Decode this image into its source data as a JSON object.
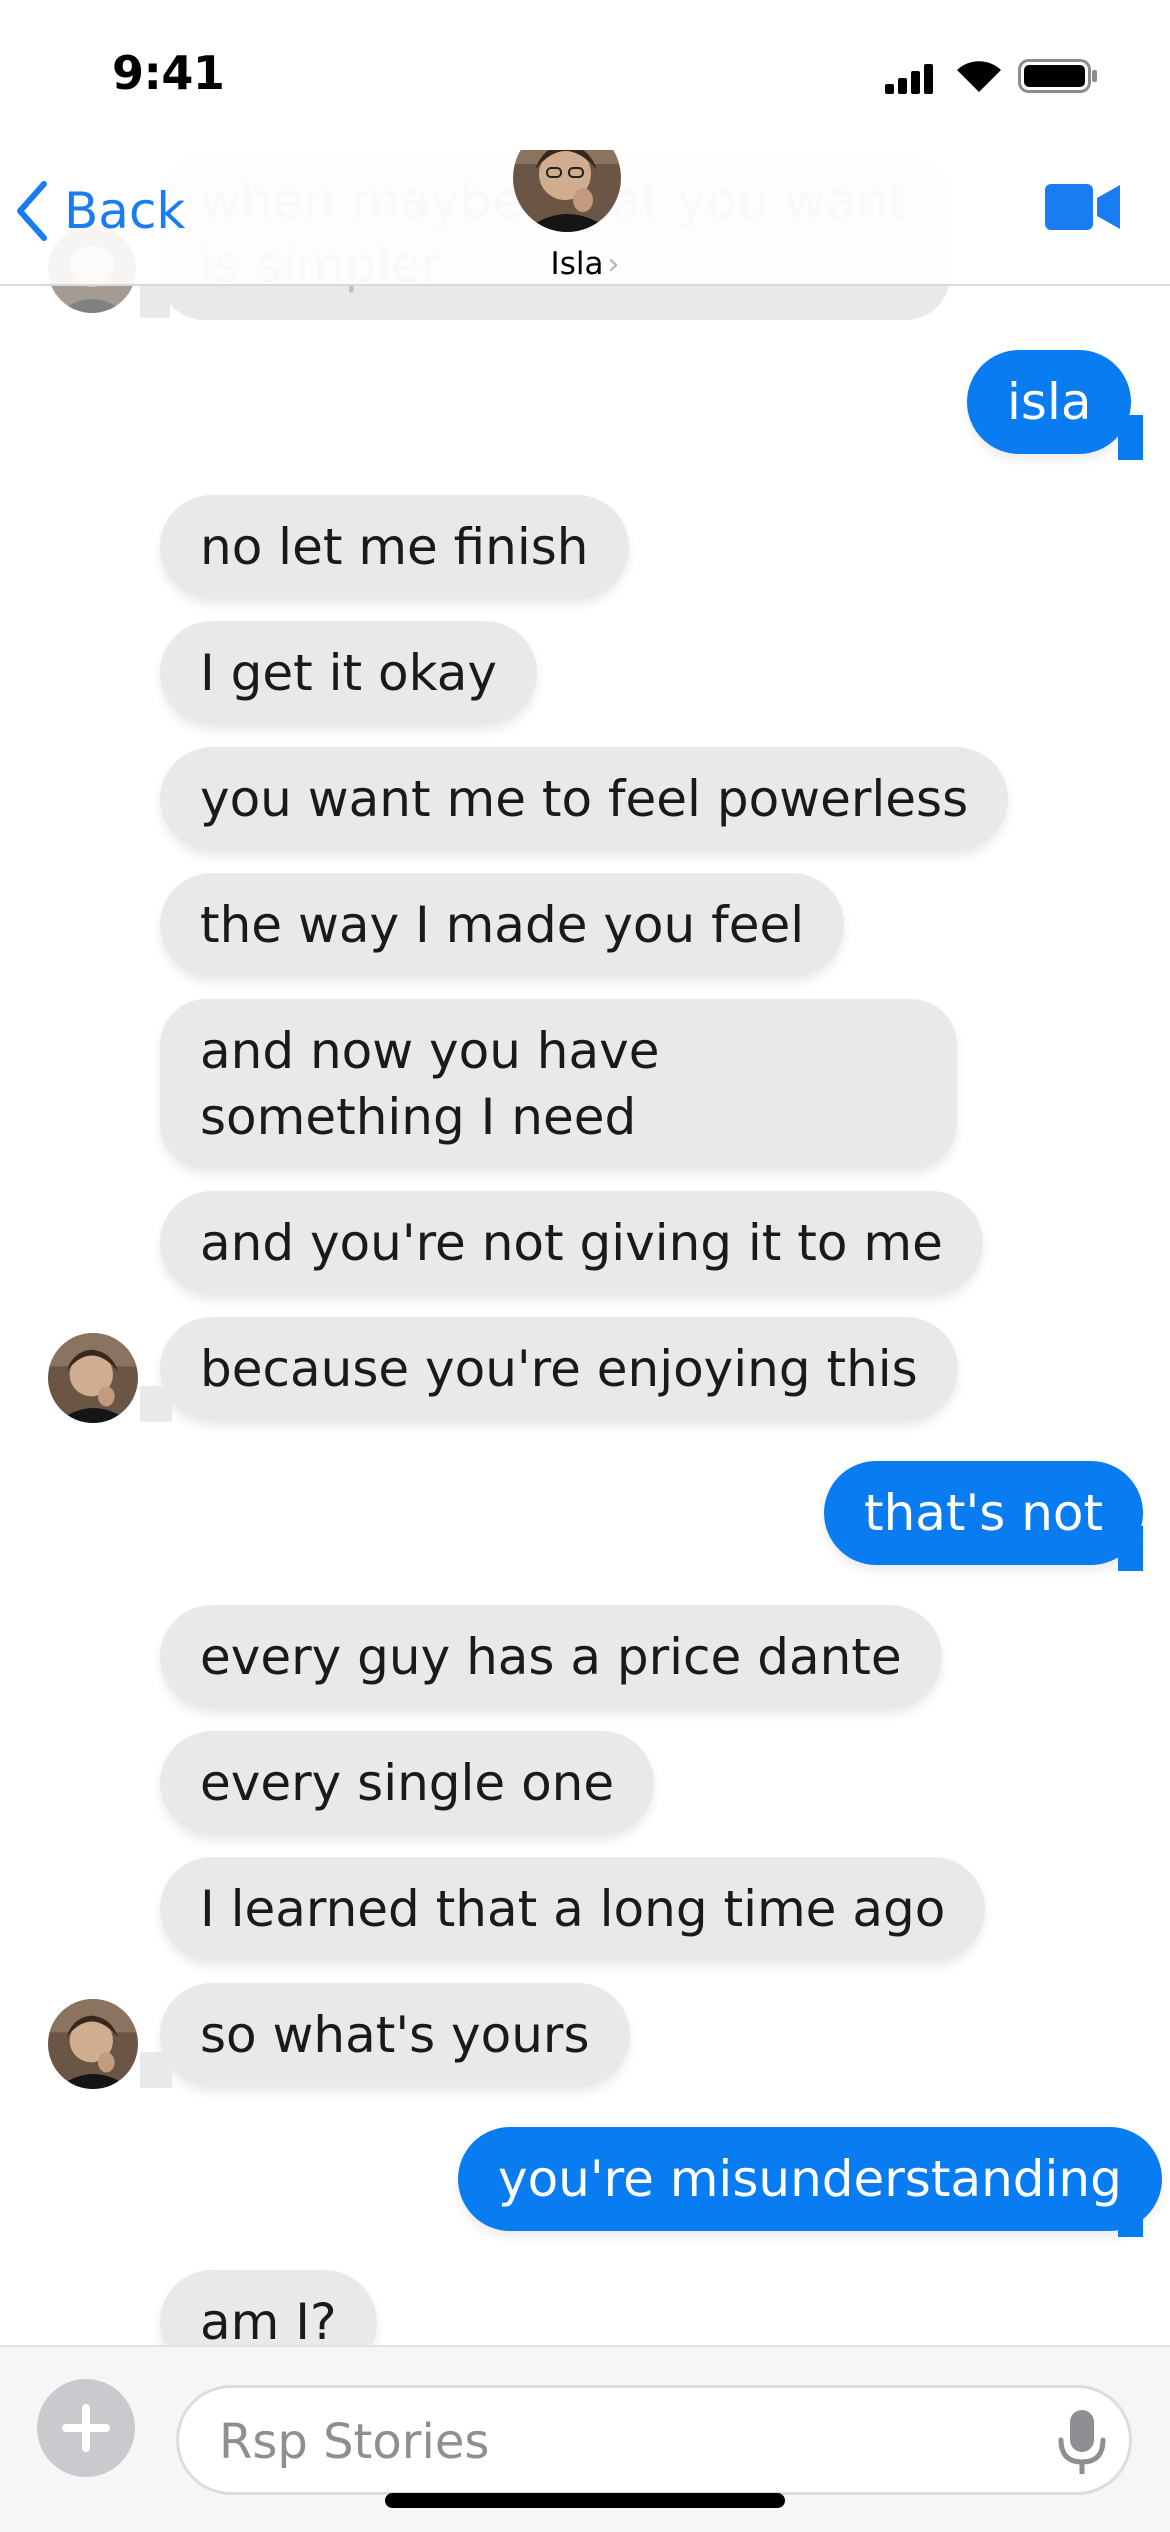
{
  "status": {
    "time": "9:41"
  },
  "nav": {
    "back_label": "Back",
    "contact_name": "Isla"
  },
  "top_faded_message": "when maybe what you want is simpler",
  "messages": {
    "m1": "isla",
    "m2": "no let me finish",
    "m3": "I get it okay",
    "m4": "you want me to feel powerless",
    "m5": "the way I made you feel",
    "m6": "and now you have something I need",
    "m7": "and you're not giving it to me",
    "m8": "because you're enjoying this",
    "m9": "that's not",
    "m10": "every guy has a price dante",
    "m11": "every single one",
    "m12": "I learned that a long time ago",
    "m13": "so what's yours",
    "m14": "you're misunderstanding",
    "m15": "am I?"
  },
  "composer": {
    "placeholder": "Rsp Stories"
  },
  "colors": {
    "accent": "#0a7cf2",
    "incoming": "#e9e9ec"
  }
}
